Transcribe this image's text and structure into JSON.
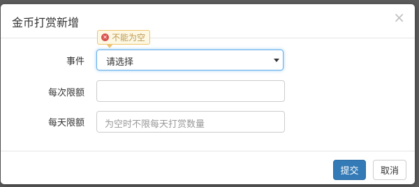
{
  "modal": {
    "title": "金币打赏新增",
    "close_symbol": "×"
  },
  "form": {
    "event": {
      "label": "事件",
      "selected": "请选择",
      "validation_message": "不能为空"
    },
    "per_time_limit": {
      "label": "每次限额",
      "value": "",
      "placeholder": ""
    },
    "per_day_limit": {
      "label": "每天限额",
      "value": "",
      "placeholder": "为空时不限每天打赏数量"
    }
  },
  "footer": {
    "submit_label": "提交",
    "cancel_label": "取消"
  },
  "colors": {
    "primary": "#337ab7",
    "warning_bg": "#fcf8e3",
    "warning_border": "#f0c36d",
    "error_icon": "#d9534f",
    "focus_border": "#66afe9"
  }
}
